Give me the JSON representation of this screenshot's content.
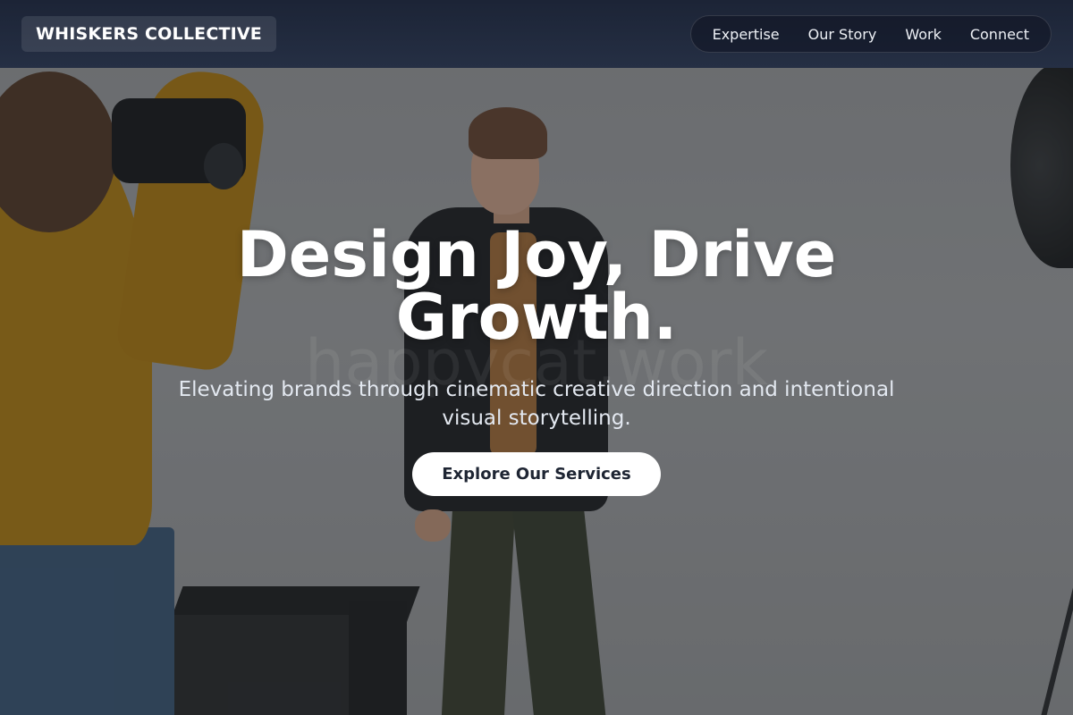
{
  "brand": {
    "logo_text": "WHISKERS COLLECTIVE"
  },
  "nav": {
    "items": [
      {
        "label": "Expertise"
      },
      {
        "label": "Our Story"
      },
      {
        "label": "Work"
      },
      {
        "label": "Connect"
      }
    ]
  },
  "hero": {
    "headline": "Design Joy, Drive Growth.",
    "subheadline": "Elevating brands through cinematic creative direction and intentional visual storytelling.",
    "cta_label": "Explore Our Services",
    "watermark": "happycat.work",
    "background_image": "photo-studio-shoot"
  },
  "colors": {
    "navbar": "#1f2839",
    "cta_background": "#ffffff",
    "cta_text": "#1e2533",
    "headline": "#ffffff"
  }
}
